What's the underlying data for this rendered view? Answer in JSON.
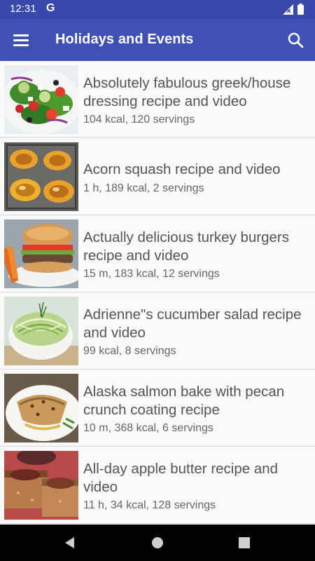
{
  "status_bar": {
    "time": "12:31",
    "g_icon": "G",
    "icons": [
      "google-icon",
      "signal-icon",
      "battery-icon"
    ]
  },
  "app_bar": {
    "title": "Holidays and Events",
    "menu_icon": "hamburger-menu-icon",
    "search_icon": "search-icon",
    "color": "#3f51b5",
    "status_color": "#3849ab"
  },
  "recipes": [
    {
      "title": "Absolutely fabulous greek/house dressing recipe and video",
      "meta": "104 kcal, 120 servings"
    },
    {
      "title": "Acorn squash recipe and video",
      "meta": "1 h, 189 kcal, 2 servings"
    },
    {
      "title": "Actually delicious turkey burgers recipe and video",
      "meta": "15 m, 183 kcal, 12 servings"
    },
    {
      "title": "Adrienne\"s cucumber salad recipe and video",
      "meta": "99 kcal, 8 servings"
    },
    {
      "title": "Alaska salmon bake with pecan crunch coating recipe",
      "meta": "10 m, 368 kcal, 6 servings"
    },
    {
      "title": "All-day apple butter recipe and video",
      "meta": "11 h, 34 kcal, 128 servings"
    }
  ],
  "nav_bar": {
    "icons": [
      "back-icon",
      "home-icon",
      "recents-icon"
    ]
  }
}
